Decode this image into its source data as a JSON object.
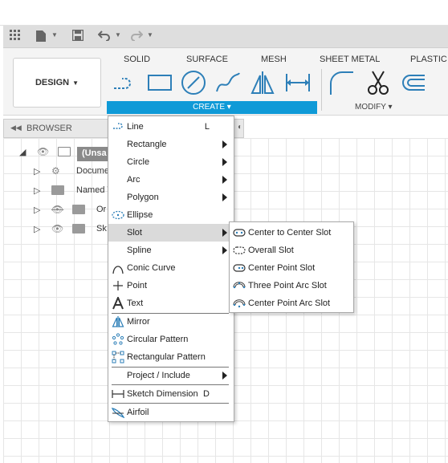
{
  "toolbar": {
    "workspace_label": "DESIGN",
    "tabs": [
      "SOLID",
      "SURFACE",
      "MESH",
      "SHEET METAL",
      "PLASTIC"
    ],
    "create_label": "CREATE",
    "modify_label": "MODIFY"
  },
  "browser": {
    "title": "BROWSER",
    "root_label": "(Unsa",
    "items": [
      {
        "label": "Docume",
        "icon": "gear-icon"
      },
      {
        "label": "Named V",
        "icon": "folder-icon"
      },
      {
        "label": "Or",
        "icon": "folder-icon"
      },
      {
        "label": "Sk",
        "icon": "folder-icon"
      }
    ]
  },
  "create_menu": {
    "items": [
      {
        "label": "Line",
        "shortcut": "L",
        "icon": "line-icon"
      },
      {
        "label": "Rectangle",
        "has_submenu": true
      },
      {
        "label": "Circle",
        "has_submenu": true
      },
      {
        "label": "Arc",
        "has_submenu": true
      },
      {
        "label": "Polygon",
        "has_submenu": true
      },
      {
        "label": "Ellipse",
        "icon": "ellipse-icon"
      },
      {
        "label": "Slot",
        "has_submenu": true,
        "highlighted": true
      },
      {
        "label": "Spline",
        "has_submenu": true
      },
      {
        "label": "Conic Curve",
        "icon": "conic-curve-icon"
      },
      {
        "label": "Point",
        "icon": "point-icon"
      },
      {
        "label": "Text",
        "icon": "text-icon"
      },
      {
        "label": "Mirror",
        "icon": "mirror-icon"
      },
      {
        "label": "Circular Pattern",
        "icon": "circular-pattern-icon"
      },
      {
        "label": "Rectangular Pattern",
        "icon": "rectangular-pattern-icon"
      },
      {
        "label": "Project / Include",
        "has_submenu": true
      },
      {
        "label": "Sketch Dimension",
        "shortcut": "D",
        "icon": "sketch-dimension-icon"
      },
      {
        "label": "Airfoil",
        "icon": "airfoil-icon"
      }
    ]
  },
  "slot_menu": {
    "items": [
      {
        "label": "Center to Center Slot",
        "icon": "center-to-center-slot-icon"
      },
      {
        "label": "Overall Slot",
        "icon": "overall-slot-icon"
      },
      {
        "label": "Center Point Slot",
        "icon": "center-point-slot-icon"
      },
      {
        "label": "Three Point Arc Slot",
        "icon": "three-point-arc-slot-icon"
      },
      {
        "label": "Center Point Arc Slot",
        "icon": "center-point-arc-slot-icon"
      }
    ]
  },
  "colors": {
    "accent": "#0f9ad7",
    "highlight": "#dadada",
    "icon_blue": "#2d7fb8"
  }
}
